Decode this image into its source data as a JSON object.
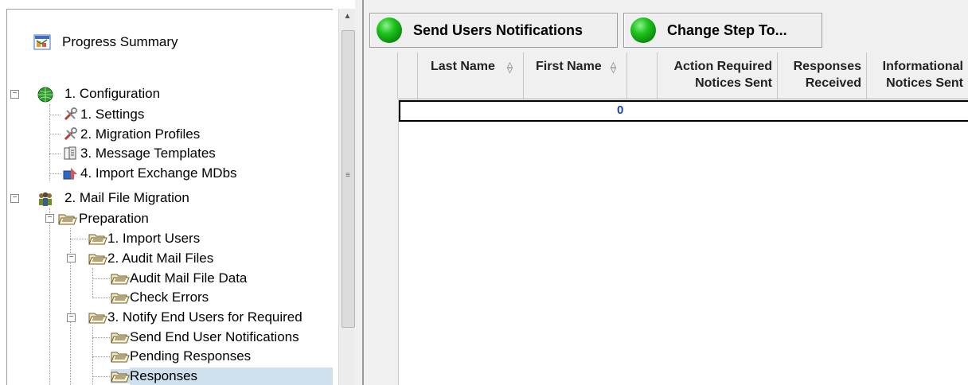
{
  "tree": {
    "progress_summary": "Progress Summary",
    "configuration": "1. Configuration",
    "settings": "1. Settings",
    "migration_profiles": "2. Migration Profiles",
    "message_templates": "3. Message Templates",
    "import_exchange": "4. Import Exchange MDbs",
    "mail_file_migration": "2. Mail File Migration",
    "preparation": "Preparation",
    "import_users": "1. Import Users",
    "audit_mail_files": "2. Audit Mail Files",
    "audit_mail_file_data": "Audit Mail File Data",
    "check_errors": "Check Errors",
    "notify_end_users": "3. Notify End Users for Required ",
    "send_end_user_notifications": "Send End User Notifications",
    "pending_responses": "Pending Responses",
    "responses": "Responses"
  },
  "toolbar": {
    "send_notifications": "Send Users Notifications",
    "change_step": "Change Step To..."
  },
  "grid": {
    "columns": [
      "Last Name",
      "First Name",
      "",
      "Action Required\nNotices Sent",
      "Responses\nReceived",
      "Informational\nNotices Sent"
    ],
    "col_last_name": "Last Name",
    "col_first_name": "First Name",
    "col_action_required_1": "Action Required",
    "col_action_required_2": "Notices Sent",
    "col_responses_1": "Responses",
    "col_responses_2": "Received",
    "col_informational_1": "Informational",
    "col_informational_2": "Notices Sent",
    "row_value": "0"
  },
  "colors": {
    "selection": "#cfe0ef",
    "accent_green": "#1fc41f",
    "value_blue": "#1a3fb0"
  },
  "icons": [
    "progress-summary-icon",
    "globe-icon",
    "wrench-icon",
    "templates-icon",
    "import-icon",
    "people-icon",
    "folder-icon",
    "green-status-icon"
  ]
}
